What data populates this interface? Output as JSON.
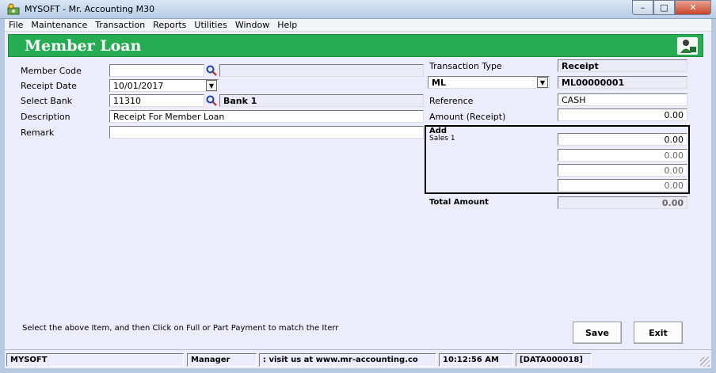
{
  "window": {
    "title": "MYSOFT - Mr. Accounting M30",
    "minimize": "–",
    "maximize": "□",
    "close": "✕"
  },
  "menu": [
    "File",
    "Maintenance",
    "Transaction",
    "Reports",
    "Utilities",
    "Window",
    "Help"
  ],
  "banner": {
    "title": "Member Loan"
  },
  "form": {
    "member_code_label": "Member Code",
    "member_code_value": "",
    "member_name_value": "",
    "receipt_date_label": "Receipt Date",
    "receipt_date_value": "10/01/2017",
    "select_bank_label": "Select Bank",
    "select_bank_value": "11310",
    "bank_name_value": "Bank 1",
    "description_label": "Description",
    "description_value": "Receipt For Member Loan",
    "remark_label": "Remark",
    "remark_value": ""
  },
  "right": {
    "transaction_type_label": "Transaction Type",
    "transaction_type_value": "Receipt",
    "doc_prefix_value": "ML",
    "doc_number_value": "ML00000001",
    "reference_label": "Reference",
    "reference_value": "CASH",
    "amount_label": "Amount (Receipt)",
    "amount_value": "0.00",
    "add_label": "Add",
    "sales_label": "Sales 1",
    "add_amounts": [
      "0.00",
      "0.00",
      "0.00",
      "0.00"
    ],
    "total_label": "Total Amount",
    "total_value": "0.00"
  },
  "hint": "Select the above Item, and then Click on Full or Part Payment to match the Iterr",
  "buttons": {
    "save": "Save",
    "exit": "Exit"
  },
  "status": {
    "company": "MYSOFT",
    "user": "Manager",
    "website": ": visit us at www.mr-accounting.co",
    "time": "10:12:56 AM",
    "data": "[DATA000018]"
  },
  "colors": {
    "banner": "#26ad54",
    "client_bg": "#ecedfc"
  },
  "icons": {
    "app": "money-icon",
    "banner": "person-icon",
    "search": "search-icon"
  }
}
